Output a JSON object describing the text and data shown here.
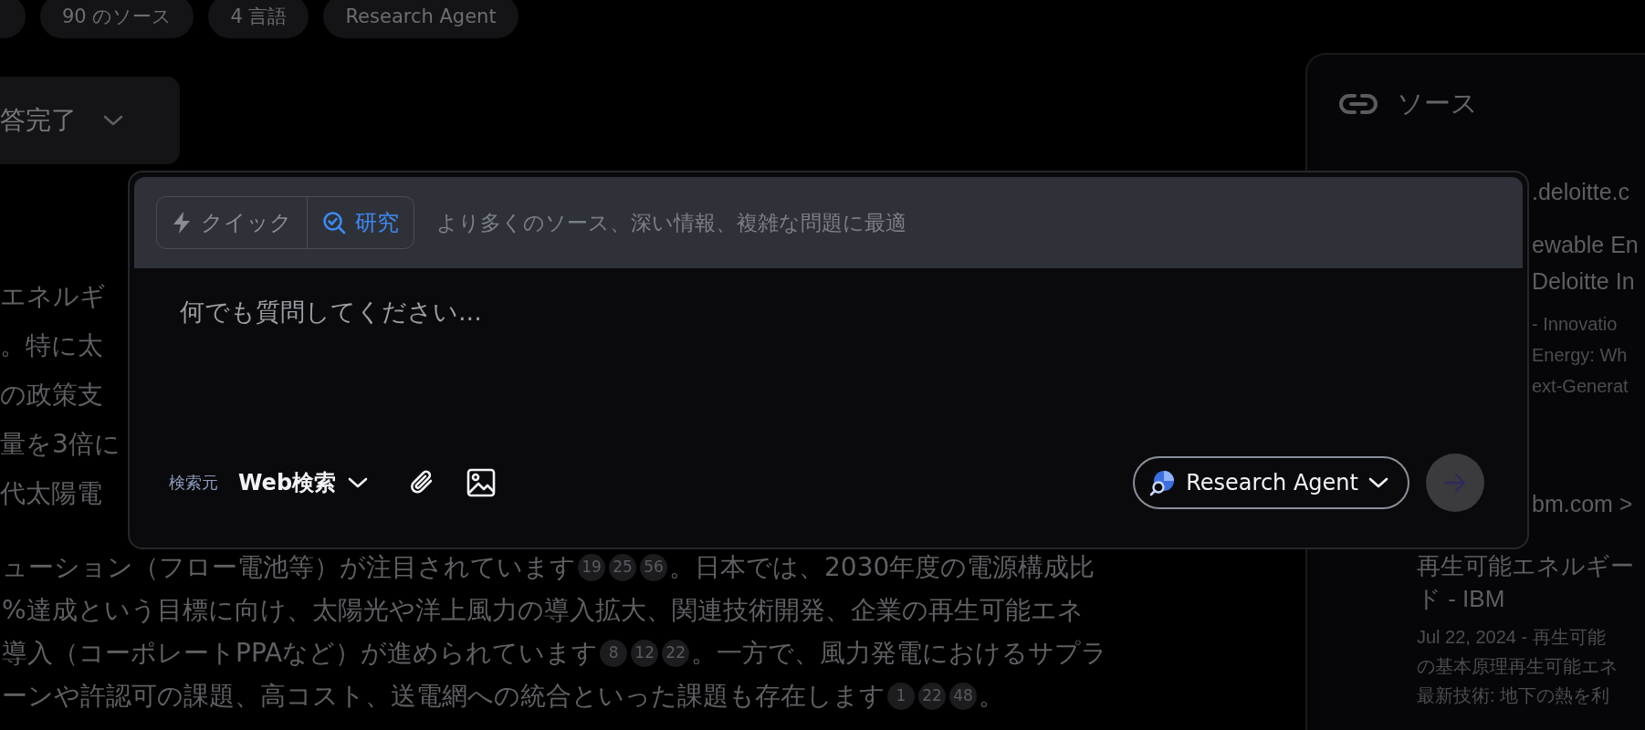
{
  "tags": [
    {
      "kind": "cut"
    },
    {
      "kind": "label",
      "label": "90 のソース"
    },
    {
      "kind": "label",
      "label": "4 言語"
    },
    {
      "kind": "label",
      "label": "Research Agent"
    }
  ],
  "status": {
    "label": "答完了"
  },
  "answer_fragments": [
    "エネルギ",
    "。特に太",
    "の政策支",
    "量を3倍に",
    "代太陽電"
  ],
  "answer_lines": [
    [
      {
        "kind": "text",
        "text": "ューション（フロー電池等）が注目されています"
      },
      {
        "kind": "cite",
        "text": "19"
      },
      {
        "kind": "cite",
        "text": "25"
      },
      {
        "kind": "cite",
        "text": "56"
      },
      {
        "kind": "text",
        "text": "。日本では、2030年度の電源構成比"
      }
    ],
    [
      {
        "kind": "text",
        "text": "%達成という目標に向け、太陽光や洋上風力の導入拡大、関連技術開発、企業の再生可能エネ"
      }
    ],
    [
      {
        "kind": "text",
        "text": "導入（コーポレートPPAなど）が進められています"
      },
      {
        "kind": "cite",
        "text": "8"
      },
      {
        "kind": "cite",
        "text": "12"
      },
      {
        "kind": "cite",
        "text": "22"
      },
      {
        "kind": "text",
        "text": "。一方で、風力発電におけるサプラ"
      }
    ],
    [
      {
        "kind": "text",
        "text": "ーンや許認可の課題、高コスト、送電網への統合といった課題も存在します"
      },
      {
        "kind": "cite",
        "text": "1"
      },
      {
        "kind": "cite",
        "text": "22"
      },
      {
        "kind": "cite",
        "text": "48"
      },
      {
        "kind": "text",
        "text": "。"
      }
    ]
  ],
  "sources_panel": {
    "title": "ソース",
    "items": [
      {
        "site": ".deloitte.c",
        "title_lines": [
          "ewable En",
          "Deloitte In"
        ],
        "snippet_lines": [
          "- Innovatio",
          "Energy: Wh",
          "ext-Generat"
        ],
        "kind": "covered"
      },
      {
        "site": "bm.com >",
        "title_lines": [
          "再生可能エネルギー",
          "ド - IBM"
        ],
        "snippet_lines": [
          "Jul 22, 2024 - 再生可能",
          "の基本原理再生可能エネ",
          "最新技術: 地下の熱を利"
        ],
        "kind": "partly_covered"
      }
    ]
  },
  "composer": {
    "modes": [
      {
        "kind": "quick",
        "label": "クイック",
        "selected": false
      },
      {
        "kind": "research",
        "label": "研究",
        "selected": true
      }
    ],
    "hint": "より多くのソース、深い情報、複雑な問題に最適",
    "placeholder": "何でも質問してください...",
    "source_label": "検索元",
    "source_value": "Web検索",
    "agent": "Research Agent"
  }
}
